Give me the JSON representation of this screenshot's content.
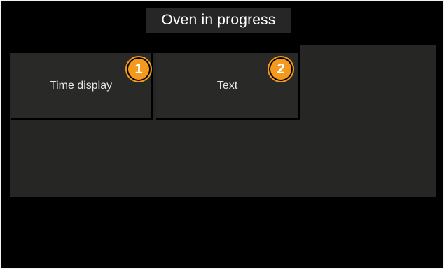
{
  "title": "Oven in progress",
  "tiles": [
    {
      "label": "Time display",
      "badge": "1"
    },
    {
      "label": "Text",
      "badge": "2"
    }
  ],
  "colors": {
    "background": "#000000",
    "panel": "#262624",
    "tile": "#292927",
    "badge": "#f39a1e",
    "border": "#f2f2f2"
  }
}
